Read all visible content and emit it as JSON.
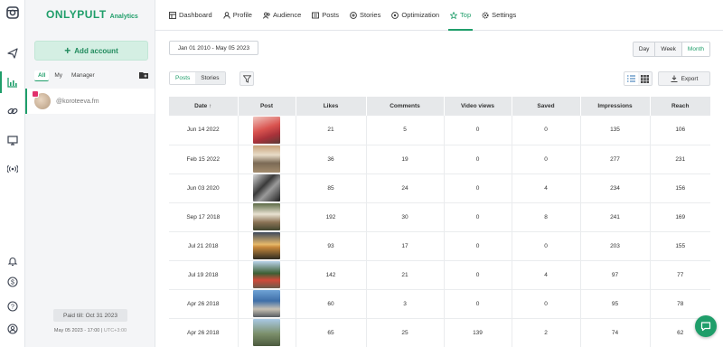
{
  "brand": {
    "name": "ONLYPULT",
    "sub": "Analytics"
  },
  "colors": {
    "accent": "#1f9e6a",
    "header_bg": "#e6e8ea"
  },
  "rail_icons": [
    "instagram-icon",
    "send-icon",
    "analytics-icon",
    "link-icon",
    "monitor-icon",
    "broadcast-icon",
    "bell-icon",
    "dollar-icon",
    "help-icon",
    "user-icon"
  ],
  "sidebar": {
    "add_account": "Add account",
    "filters": [
      "All",
      "My",
      "Manager"
    ],
    "account_handle": "@koroteeva.fm",
    "paid_till": "Paid till: Oct 31 2023",
    "clock": "May 05 2023 - 17:00",
    "timezone": "UTC+3:00"
  },
  "nav": {
    "tabs": [
      {
        "label": "Dashboard",
        "icon": "dashboard-icon"
      },
      {
        "label": "Profile",
        "icon": "profile-icon"
      },
      {
        "label": "Audience",
        "icon": "audience-icon"
      },
      {
        "label": "Posts",
        "icon": "posts-icon"
      },
      {
        "label": "Stories",
        "icon": "stories-icon"
      },
      {
        "label": "Optimization",
        "icon": "optimization-icon"
      },
      {
        "label": "Top",
        "icon": "star-icon",
        "active": true
      },
      {
        "label": "Settings",
        "icon": "settings-icon"
      }
    ]
  },
  "toolbar": {
    "date_range": "Jan 01 2010 - May 05 2023",
    "period": [
      "Day",
      "Week",
      "Month"
    ],
    "period_selected": "Month",
    "segments": [
      "Posts",
      "Stories"
    ],
    "segment_selected": "Posts",
    "export": "Export"
  },
  "table": {
    "columns": [
      "Date",
      "Post",
      "Likes",
      "Comments",
      "Video views",
      "Saved",
      "Impressions",
      "Reach"
    ],
    "sort_indicator": "↑",
    "rows": [
      {
        "date": "Jun 14 2022",
        "likes": "21",
        "comments": "5",
        "video_views": "0",
        "saved": "0",
        "impressions": "135",
        "reach": "106",
        "thumb": "red"
      },
      {
        "date": "Feb 15 2022",
        "likes": "36",
        "comments": "19",
        "video_views": "0",
        "saved": "0",
        "impressions": "277",
        "reach": "231",
        "thumb": "room"
      },
      {
        "date": "Jun 03 2020",
        "likes": "85",
        "comments": "24",
        "video_views": "0",
        "saved": "4",
        "impressions": "234",
        "reach": "156",
        "thumb": "bw"
      },
      {
        "date": "Sep 17 2018",
        "likes": "192",
        "comments": "30",
        "video_views": "0",
        "saved": "8",
        "impressions": "241",
        "reach": "169",
        "thumb": "portrait"
      },
      {
        "date": "Jul 21 2018",
        "likes": "93",
        "comments": "17",
        "video_views": "0",
        "saved": "0",
        "impressions": "203",
        "reach": "155",
        "thumb": "sunset"
      },
      {
        "date": "Jul 19 2018",
        "likes": "142",
        "comments": "21",
        "video_views": "0",
        "saved": "4",
        "impressions": "97",
        "reach": "77",
        "thumb": "tree"
      },
      {
        "date": "Apr 26 2018",
        "likes": "60",
        "comments": "3",
        "video_views": "0",
        "saved": "0",
        "impressions": "95",
        "reach": "78",
        "thumb": "street"
      },
      {
        "date": "Apr 26 2018",
        "likes": "65",
        "comments": "25",
        "video_views": "139",
        "saved": "2",
        "impressions": "74",
        "reach": "62",
        "thumb": "sky"
      }
    ]
  }
}
